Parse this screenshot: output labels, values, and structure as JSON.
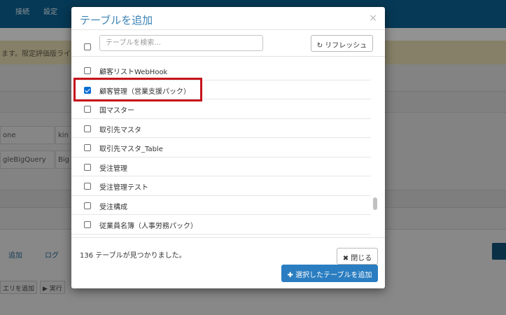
{
  "topnav": {
    "items": [
      "接続",
      "設定"
    ]
  },
  "background": {
    "warning_text": "ます。限定評価版ライセ",
    "rows": [
      {
        "left": "one",
        "right": "kin"
      },
      {
        "left": "gleBigQuery",
        "right": "Big"
      }
    ],
    "tabs": [
      "追加",
      "ログ"
    ],
    "buttons": [
      "エリを追加",
      "▶ 実行"
    ]
  },
  "modal": {
    "title": "テーブルを追加",
    "close_symbol": "×",
    "search_placeholder": "テーブルを検索...",
    "refresh_label": "リフレッシュ",
    "tables": [
      {
        "label": "顧客リストWebHook",
        "checked": false
      },
      {
        "label": "顧客管理（営業支援パック）",
        "checked": true
      },
      {
        "label": "国マスター",
        "checked": false
      },
      {
        "label": "取引先マスタ",
        "checked": false
      },
      {
        "label": "取引先マスタ_Table",
        "checked": false
      },
      {
        "label": "受注管理",
        "checked": false
      },
      {
        "label": "受注管理テスト",
        "checked": false
      },
      {
        "label": "受注構成",
        "checked": false
      },
      {
        "label": "従業員名簿（人事労務パック）",
        "checked": false
      }
    ],
    "found_text": "136 テーブルが見つかりました。",
    "close_label": "閉じる",
    "add_label": "選択したテーブルを追加"
  },
  "colors": {
    "header_bg": "#0b5d8a",
    "accent": "#2a7dc0",
    "highlight": "#c6141b"
  }
}
